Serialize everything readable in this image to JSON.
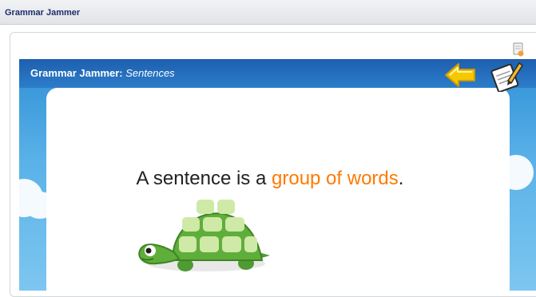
{
  "app": {
    "title": "Grammar Jammer"
  },
  "activity": {
    "title_main": "Grammar Jammer:",
    "title_topic": "Sentences"
  },
  "content": {
    "sentence_start": "A sentence is a ",
    "sentence_highlight": "group of words",
    "sentence_end": "."
  },
  "colors": {
    "header_blue": "#1d5fae",
    "sky_blue": "#5bb2e8",
    "highlight_orange": "#ff7a00",
    "arrow_yellow": "#f6c800",
    "turtle_green": "#5fae3b"
  },
  "icons": {
    "doc": "document-icon",
    "back": "back-arrow-icon",
    "notes": "notepad-pencil-icon",
    "mascot": "turtle-icon"
  }
}
